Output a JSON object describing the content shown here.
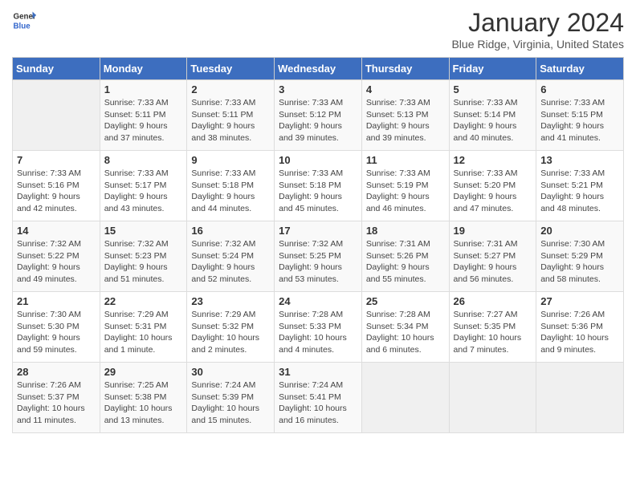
{
  "header": {
    "logo_general": "General",
    "logo_blue": "Blue",
    "title": "January 2024",
    "subtitle": "Blue Ridge, Virginia, United States"
  },
  "calendar": {
    "days_of_week": [
      "Sunday",
      "Monday",
      "Tuesday",
      "Wednesday",
      "Thursday",
      "Friday",
      "Saturday"
    ],
    "weeks": [
      [
        {
          "day": "",
          "info": ""
        },
        {
          "day": "1",
          "info": "Sunrise: 7:33 AM\nSunset: 5:11 PM\nDaylight: 9 hours\nand 37 minutes."
        },
        {
          "day": "2",
          "info": "Sunrise: 7:33 AM\nSunset: 5:11 PM\nDaylight: 9 hours\nand 38 minutes."
        },
        {
          "day": "3",
          "info": "Sunrise: 7:33 AM\nSunset: 5:12 PM\nDaylight: 9 hours\nand 39 minutes."
        },
        {
          "day": "4",
          "info": "Sunrise: 7:33 AM\nSunset: 5:13 PM\nDaylight: 9 hours\nand 39 minutes."
        },
        {
          "day": "5",
          "info": "Sunrise: 7:33 AM\nSunset: 5:14 PM\nDaylight: 9 hours\nand 40 minutes."
        },
        {
          "day": "6",
          "info": "Sunrise: 7:33 AM\nSunset: 5:15 PM\nDaylight: 9 hours\nand 41 minutes."
        }
      ],
      [
        {
          "day": "7",
          "info": "Sunrise: 7:33 AM\nSunset: 5:16 PM\nDaylight: 9 hours\nand 42 minutes."
        },
        {
          "day": "8",
          "info": "Sunrise: 7:33 AM\nSunset: 5:17 PM\nDaylight: 9 hours\nand 43 minutes."
        },
        {
          "day": "9",
          "info": "Sunrise: 7:33 AM\nSunset: 5:18 PM\nDaylight: 9 hours\nand 44 minutes."
        },
        {
          "day": "10",
          "info": "Sunrise: 7:33 AM\nSunset: 5:18 PM\nDaylight: 9 hours\nand 45 minutes."
        },
        {
          "day": "11",
          "info": "Sunrise: 7:33 AM\nSunset: 5:19 PM\nDaylight: 9 hours\nand 46 minutes."
        },
        {
          "day": "12",
          "info": "Sunrise: 7:33 AM\nSunset: 5:20 PM\nDaylight: 9 hours\nand 47 minutes."
        },
        {
          "day": "13",
          "info": "Sunrise: 7:33 AM\nSunset: 5:21 PM\nDaylight: 9 hours\nand 48 minutes."
        }
      ],
      [
        {
          "day": "14",
          "info": "Sunrise: 7:32 AM\nSunset: 5:22 PM\nDaylight: 9 hours\nand 49 minutes."
        },
        {
          "day": "15",
          "info": "Sunrise: 7:32 AM\nSunset: 5:23 PM\nDaylight: 9 hours\nand 51 minutes."
        },
        {
          "day": "16",
          "info": "Sunrise: 7:32 AM\nSunset: 5:24 PM\nDaylight: 9 hours\nand 52 minutes."
        },
        {
          "day": "17",
          "info": "Sunrise: 7:32 AM\nSunset: 5:25 PM\nDaylight: 9 hours\nand 53 minutes."
        },
        {
          "day": "18",
          "info": "Sunrise: 7:31 AM\nSunset: 5:26 PM\nDaylight: 9 hours\nand 55 minutes."
        },
        {
          "day": "19",
          "info": "Sunrise: 7:31 AM\nSunset: 5:27 PM\nDaylight: 9 hours\nand 56 minutes."
        },
        {
          "day": "20",
          "info": "Sunrise: 7:30 AM\nSunset: 5:29 PM\nDaylight: 9 hours\nand 58 minutes."
        }
      ],
      [
        {
          "day": "21",
          "info": "Sunrise: 7:30 AM\nSunset: 5:30 PM\nDaylight: 9 hours\nand 59 minutes."
        },
        {
          "day": "22",
          "info": "Sunrise: 7:29 AM\nSunset: 5:31 PM\nDaylight: 10 hours\nand 1 minute."
        },
        {
          "day": "23",
          "info": "Sunrise: 7:29 AM\nSunset: 5:32 PM\nDaylight: 10 hours\nand 2 minutes."
        },
        {
          "day": "24",
          "info": "Sunrise: 7:28 AM\nSunset: 5:33 PM\nDaylight: 10 hours\nand 4 minutes."
        },
        {
          "day": "25",
          "info": "Sunrise: 7:28 AM\nSunset: 5:34 PM\nDaylight: 10 hours\nand 6 minutes."
        },
        {
          "day": "26",
          "info": "Sunrise: 7:27 AM\nSunset: 5:35 PM\nDaylight: 10 hours\nand 7 minutes."
        },
        {
          "day": "27",
          "info": "Sunrise: 7:26 AM\nSunset: 5:36 PM\nDaylight: 10 hours\nand 9 minutes."
        }
      ],
      [
        {
          "day": "28",
          "info": "Sunrise: 7:26 AM\nSunset: 5:37 PM\nDaylight: 10 hours\nand 11 minutes."
        },
        {
          "day": "29",
          "info": "Sunrise: 7:25 AM\nSunset: 5:38 PM\nDaylight: 10 hours\nand 13 minutes."
        },
        {
          "day": "30",
          "info": "Sunrise: 7:24 AM\nSunset: 5:39 PM\nDaylight: 10 hours\nand 15 minutes."
        },
        {
          "day": "31",
          "info": "Sunrise: 7:24 AM\nSunset: 5:41 PM\nDaylight: 10 hours\nand 16 minutes."
        },
        {
          "day": "",
          "info": ""
        },
        {
          "day": "",
          "info": ""
        },
        {
          "day": "",
          "info": ""
        }
      ]
    ]
  }
}
